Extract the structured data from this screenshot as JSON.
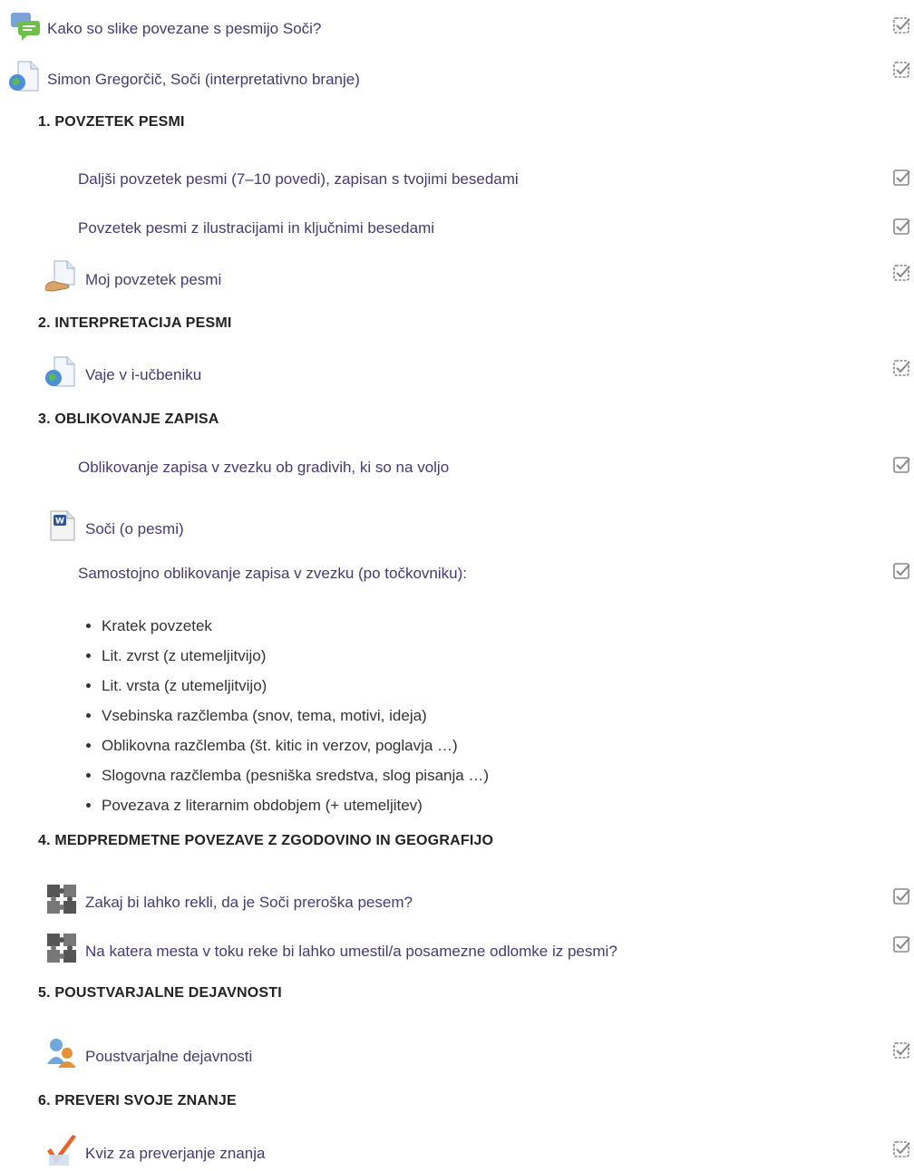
{
  "activities": {
    "forum": "Kako so slike povezane s pesmijo Soči?",
    "reading": "Simon Gregorčič, Soči (interpretativno branje)",
    "summary_long": "Daljši povzetek pesmi (7–10 povedi), zapisan s tvojimi besedami",
    "summary_illustrated": "Povzetek pesmi z ilustracijami in ključnimi besedami",
    "my_summary": "Moj povzetek pesmi",
    "exercises": "Vaje v i-učbeniku",
    "notes_format": "Oblikovanje zapisa v zvezku ob gradivih, ki so na voljo",
    "about_poem": "Soči (o pesmi)",
    "self_notes": "Samostojno oblikovanje zapisa v zvezku (po točkovniku):",
    "prophetic": "Zakaj bi lahko rekli, da je Soči preroška pesem?",
    "river_places": "Na katera mesta v toku reke bi lahko umestil/a posamezne odlomke iz pesmi?",
    "creative": "Poustvarjalne dejavnosti",
    "quiz": "Kviz za preverjanje znanja"
  },
  "sections": {
    "s1": "1. POVZETEK PESMI",
    "s2": "2. INTERPRETACIJA PESMI",
    "s3": "3. OBLIKOVANJE ZAPISA",
    "s4": "4. MEDPREDMETNE POVEZAVE Z ZGODOVINO IN GEOGRAFIJO",
    "s5": "5. POUSTVARJALNE DEJAVNOSTI",
    "s6": "6. PREVERI SVOJE ZNANJE"
  },
  "checklist_points": [
    "Kratek povzetek",
    "Lit. zvrst (z utemeljitvijo)",
    "Lit. vrsta (z utemeljitvijo)",
    "Vsebinska razčlemba (snov, tema, motivi, ideja)",
    "Oblikovna razčlemba (št. kitic in verzov, poglavja …)",
    "Slogovna razčlemba (pesniška sredstva, slog pisanja …)",
    "Povezava z literarnim obdobjem (+ utemeljitev)"
  ],
  "colors": {
    "link": "#473a70",
    "heading": "#222222",
    "checkbox": "#888888"
  },
  "icons": {
    "forum": "forum-icon",
    "url": "globe-document-icon",
    "assign": "assignment-icon",
    "word": "word-document-icon",
    "puzzle": "puzzle-icon",
    "people": "people-icon",
    "quiz": "quiz-icon",
    "check": "completion-checkbox-icon"
  }
}
